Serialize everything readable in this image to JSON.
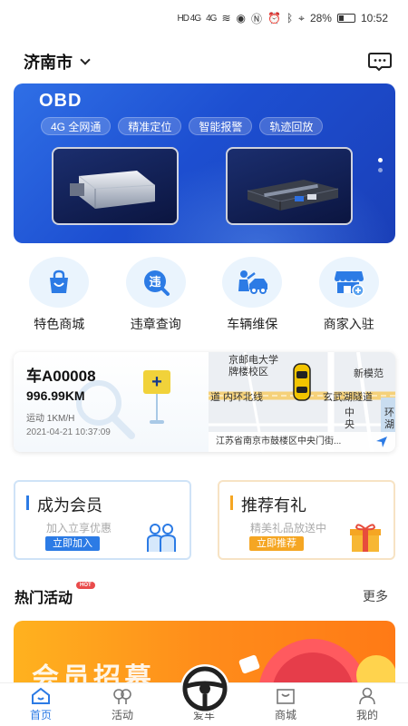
{
  "status_bar": {
    "signal1": "HD 4G",
    "signal2": "4G",
    "battery": "28%",
    "time": "10:52"
  },
  "header": {
    "city": "济南市"
  },
  "banner": {
    "title": "OBD",
    "tags": [
      "4G 全网通",
      "精准定位",
      "智能报警",
      "轨迹回放"
    ]
  },
  "quick_menu": [
    {
      "label": "特色商城",
      "icon": "shopping-bag-icon"
    },
    {
      "label": "违章查询",
      "icon": "violation-search-icon"
    },
    {
      "label": "车辆维保",
      "icon": "car-repair-icon"
    },
    {
      "label": "商家入驻",
      "icon": "shop-join-icon"
    }
  ],
  "car": {
    "plate": "车A00008",
    "mileage": "996.99KM",
    "status": "运动 1KM/H",
    "time": "2021-04-21 10:37:09",
    "map_labels": [
      "京邮电大学",
      "牌楼校区",
      "新模范",
      "道 内环北线",
      "玄武湖隧道",
      "中",
      "央",
      "环",
      "湖"
    ],
    "address": "江苏省南京市鼓楼区中央门街..."
  },
  "promos": {
    "member": {
      "title": "成为会员",
      "subtitle": "加入立享优惠",
      "button": "立即加入"
    },
    "refer": {
      "title": "推荐有礼",
      "subtitle": "精美礼品放送中",
      "button": "立即推荐"
    }
  },
  "hot": {
    "title": "热门活动",
    "badge": "HOT",
    "more": "更多",
    "banner_text": "会员招募"
  },
  "nav": {
    "home": "首页",
    "activity": "活动",
    "car": "爱车",
    "mall": "商城",
    "mine": "我的"
  },
  "colors": {
    "primary": "#2c7be5",
    "orange": "#f5a623",
    "banner_blue": "#1d4fd1"
  }
}
